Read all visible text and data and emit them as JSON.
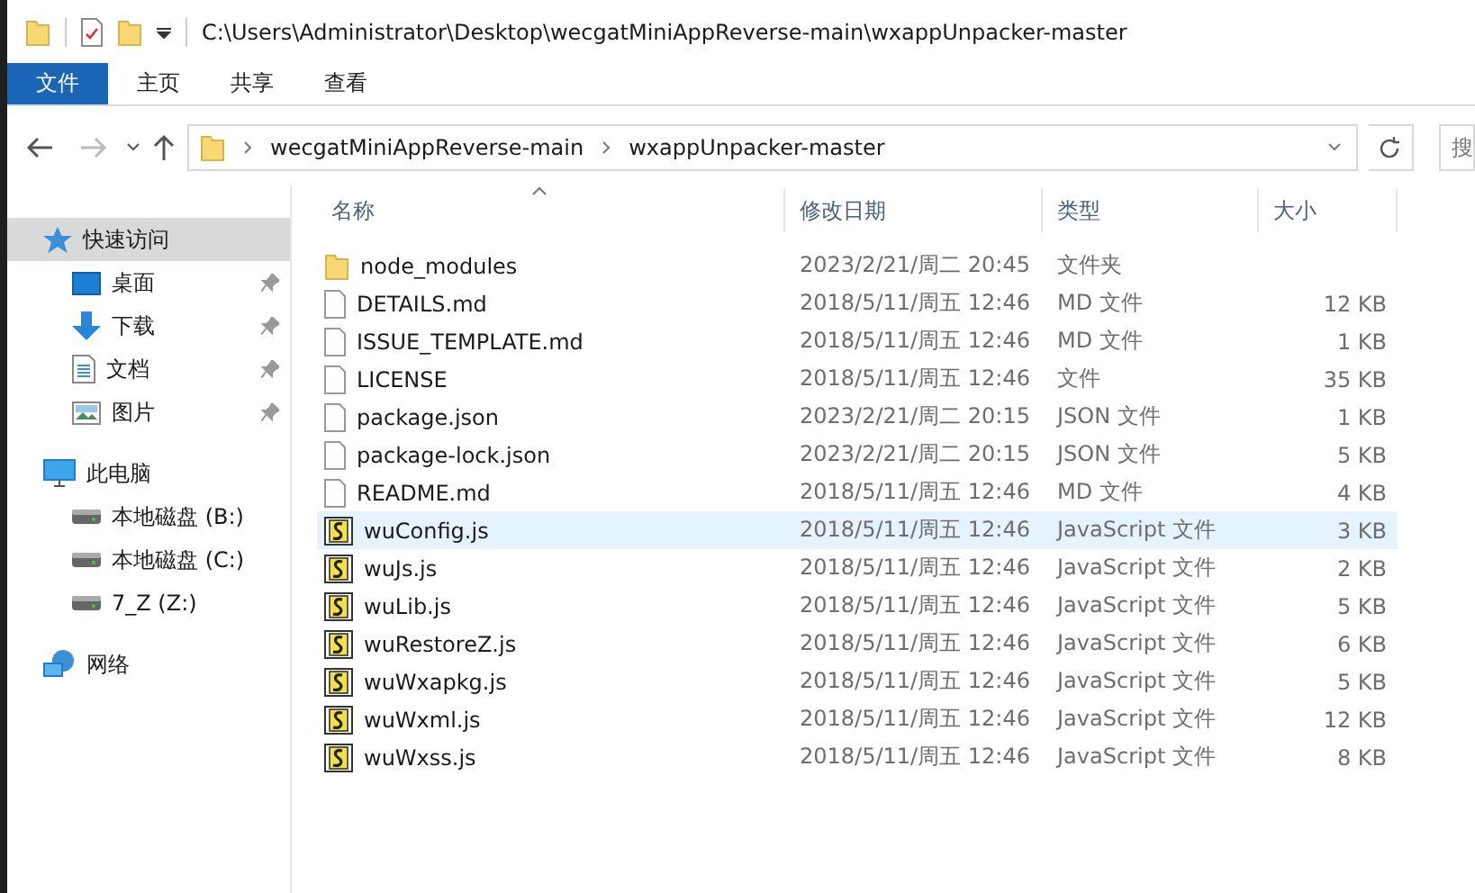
{
  "title_bar": {
    "path": "C:\\Users\\Administrator\\Desktop\\wecgatMiniAppReverse-main\\wxappUnpacker-master"
  },
  "ribbon_tabs": [
    {
      "label": "文件",
      "selected": true
    },
    {
      "label": "主页",
      "selected": false
    },
    {
      "label": "共享",
      "selected": false
    },
    {
      "label": "查看",
      "selected": false
    }
  ],
  "address_bar": {
    "breadcrumbs": [
      "wecgatMiniAppReverse-main",
      "wxappUnpacker-master"
    ]
  },
  "search": {
    "placeholder": "搜"
  },
  "sidebar": {
    "items": [
      {
        "label": "快速访问",
        "kind": "star",
        "selected": true,
        "children": [
          {
            "label": "桌面",
            "kind": "desktop",
            "pinned": true,
            "selected": false
          },
          {
            "label": "下载",
            "kind": "download",
            "pinned": true,
            "selected": false
          },
          {
            "label": "文档",
            "kind": "document",
            "pinned": true,
            "selected": false
          },
          {
            "label": "图片",
            "kind": "picture",
            "pinned": true,
            "selected": false
          }
        ]
      },
      {
        "label": "此电脑",
        "kind": "computer",
        "selected": false,
        "children": [
          {
            "label": "本地磁盘 (B:)",
            "kind": "drive",
            "selected": false
          },
          {
            "label": "本地磁盘 (C:)",
            "kind": "drive",
            "selected": false
          },
          {
            "label": "7_Z (Z:)",
            "kind": "drive",
            "selected": false
          }
        ]
      },
      {
        "label": "网络",
        "kind": "network",
        "selected": false
      }
    ]
  },
  "table": {
    "columns": [
      "名称",
      "修改日期",
      "类型",
      "大小"
    ],
    "rows": [
      {
        "kind": "folder",
        "name": "node_modules",
        "date": "2023/2/21/周二 20:45",
        "type": "文件夹",
        "selected": false
      },
      {
        "kind": "file",
        "name": "DETAILS.md",
        "date": "2018/5/11/周五 12:46",
        "type": "MD 文件",
        "size": "12 KB",
        "selected": false
      },
      {
        "kind": "file",
        "name": "ISSUE_TEMPLATE.md",
        "date": "2018/5/11/周五 12:46",
        "type": "MD 文件",
        "size": "1 KB",
        "selected": false
      },
      {
        "kind": "file",
        "name": "LICENSE",
        "date": "2018/5/11/周五 12:46",
        "type": "文件",
        "size": "35 KB",
        "selected": false
      },
      {
        "kind": "file",
        "name": "package.json",
        "date": "2023/2/21/周二 20:15",
        "type": "JSON 文件",
        "size": "1 KB",
        "selected": false
      },
      {
        "kind": "file",
        "name": "package-lock.json",
        "date": "2023/2/21/周二 20:15",
        "type": "JSON 文件",
        "size": "5 KB",
        "selected": false
      },
      {
        "kind": "file",
        "name": "README.md",
        "date": "2018/5/11/周五 12:46",
        "type": "MD 文件",
        "size": "4 KB",
        "selected": false
      },
      {
        "kind": "script",
        "name": "wuConfig.js",
        "date": "2018/5/11/周五 12:46",
        "type": "JavaScript 文件",
        "size": "3 KB",
        "selected": true
      },
      {
        "kind": "script",
        "name": "wuJs.js",
        "date": "2018/5/11/周五 12:46",
        "type": "JavaScript 文件",
        "size": "2 KB",
        "selected": false
      },
      {
        "kind": "script",
        "name": "wuLib.js",
        "date": "2018/5/11/周五 12:46",
        "type": "JavaScript 文件",
        "size": "5 KB",
        "selected": false
      },
      {
        "kind": "script",
        "name": "wuRestoreZ.js",
        "date": "2018/5/11/周五 12:46",
        "type": "JavaScript 文件",
        "size": "6 KB",
        "selected": false
      },
      {
        "kind": "script",
        "name": "wuWxapkg.js",
        "date": "2018/5/11/周五 12:46",
        "type": "JavaScript 文件",
        "size": "5 KB",
        "selected": false
      },
      {
        "kind": "script",
        "name": "wuWxml.js",
        "date": "2018/5/11/周五 12:46",
        "type": "JavaScript 文件",
        "size": "12 KB",
        "selected": false
      },
      {
        "kind": "script",
        "name": "wuWxss.js",
        "date": "2018/5/11/周五 12:46",
        "type": "JavaScript 文件",
        "size": "8 KB",
        "selected": false
      }
    ]
  }
}
